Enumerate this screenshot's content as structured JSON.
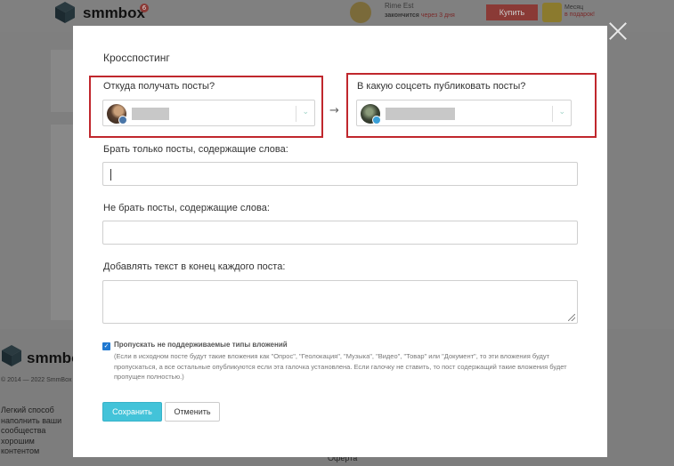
{
  "background": {
    "logo_text": "smmbox",
    "notification_count": "6",
    "user_name": "Rime Est",
    "plan_text": "закончится",
    "plan_deadline": "через 3 дня",
    "buy_label": "Купить",
    "gift_line1": "Месяц",
    "gift_line2": "в подарок!",
    "footer_logo": "smmbox",
    "copyright": "© 2014 — 2022 SmmBox",
    "slogan": "Легкий способ наполнить ваши сообщества хорошим контентом",
    "offer_link": "Оферта"
  },
  "modal": {
    "title": "Кросспостинг",
    "source_label": "Откуда получать посты?",
    "destination_label": "В какую соцсеть публиковать посты?",
    "arrow": "→",
    "include_words_label": "Брать только посты, содержащие слова:",
    "include_words_value": "",
    "exclude_words_label": "Не брать посты, содержащие слова:",
    "exclude_words_value": "",
    "append_text_label": "Добавлять текст в конец каждого поста:",
    "append_text_value": "",
    "skip_checkbox_label": "Пропускать не поддерживаемые типы вложений",
    "skip_checkbox_checked": true,
    "skip_checkbox_note": "(Если в исходном посте будут такие вложения как \"Опрос\", \"Геолокация\", \"Музыка\", \"Видео\", \"Товар\" или \"Документ\", то эти вложения будут пропускаться, а все остальные опубликуются если эта галочка установлена. Если галочку не ставить, то пост содержащий такие вложения будет пропущен полностью.)",
    "save_label": "Сохранить",
    "cancel_label": "Отменить"
  },
  "colors": {
    "highlight_border": "#c0272d",
    "save_button": "#43c3d9",
    "checkbox": "#1f78d0"
  },
  "icons": {
    "close": "close-icon",
    "chevron": "chevron-down-icon",
    "source_network": "vk-icon",
    "destination_network": "telegram-icon"
  }
}
